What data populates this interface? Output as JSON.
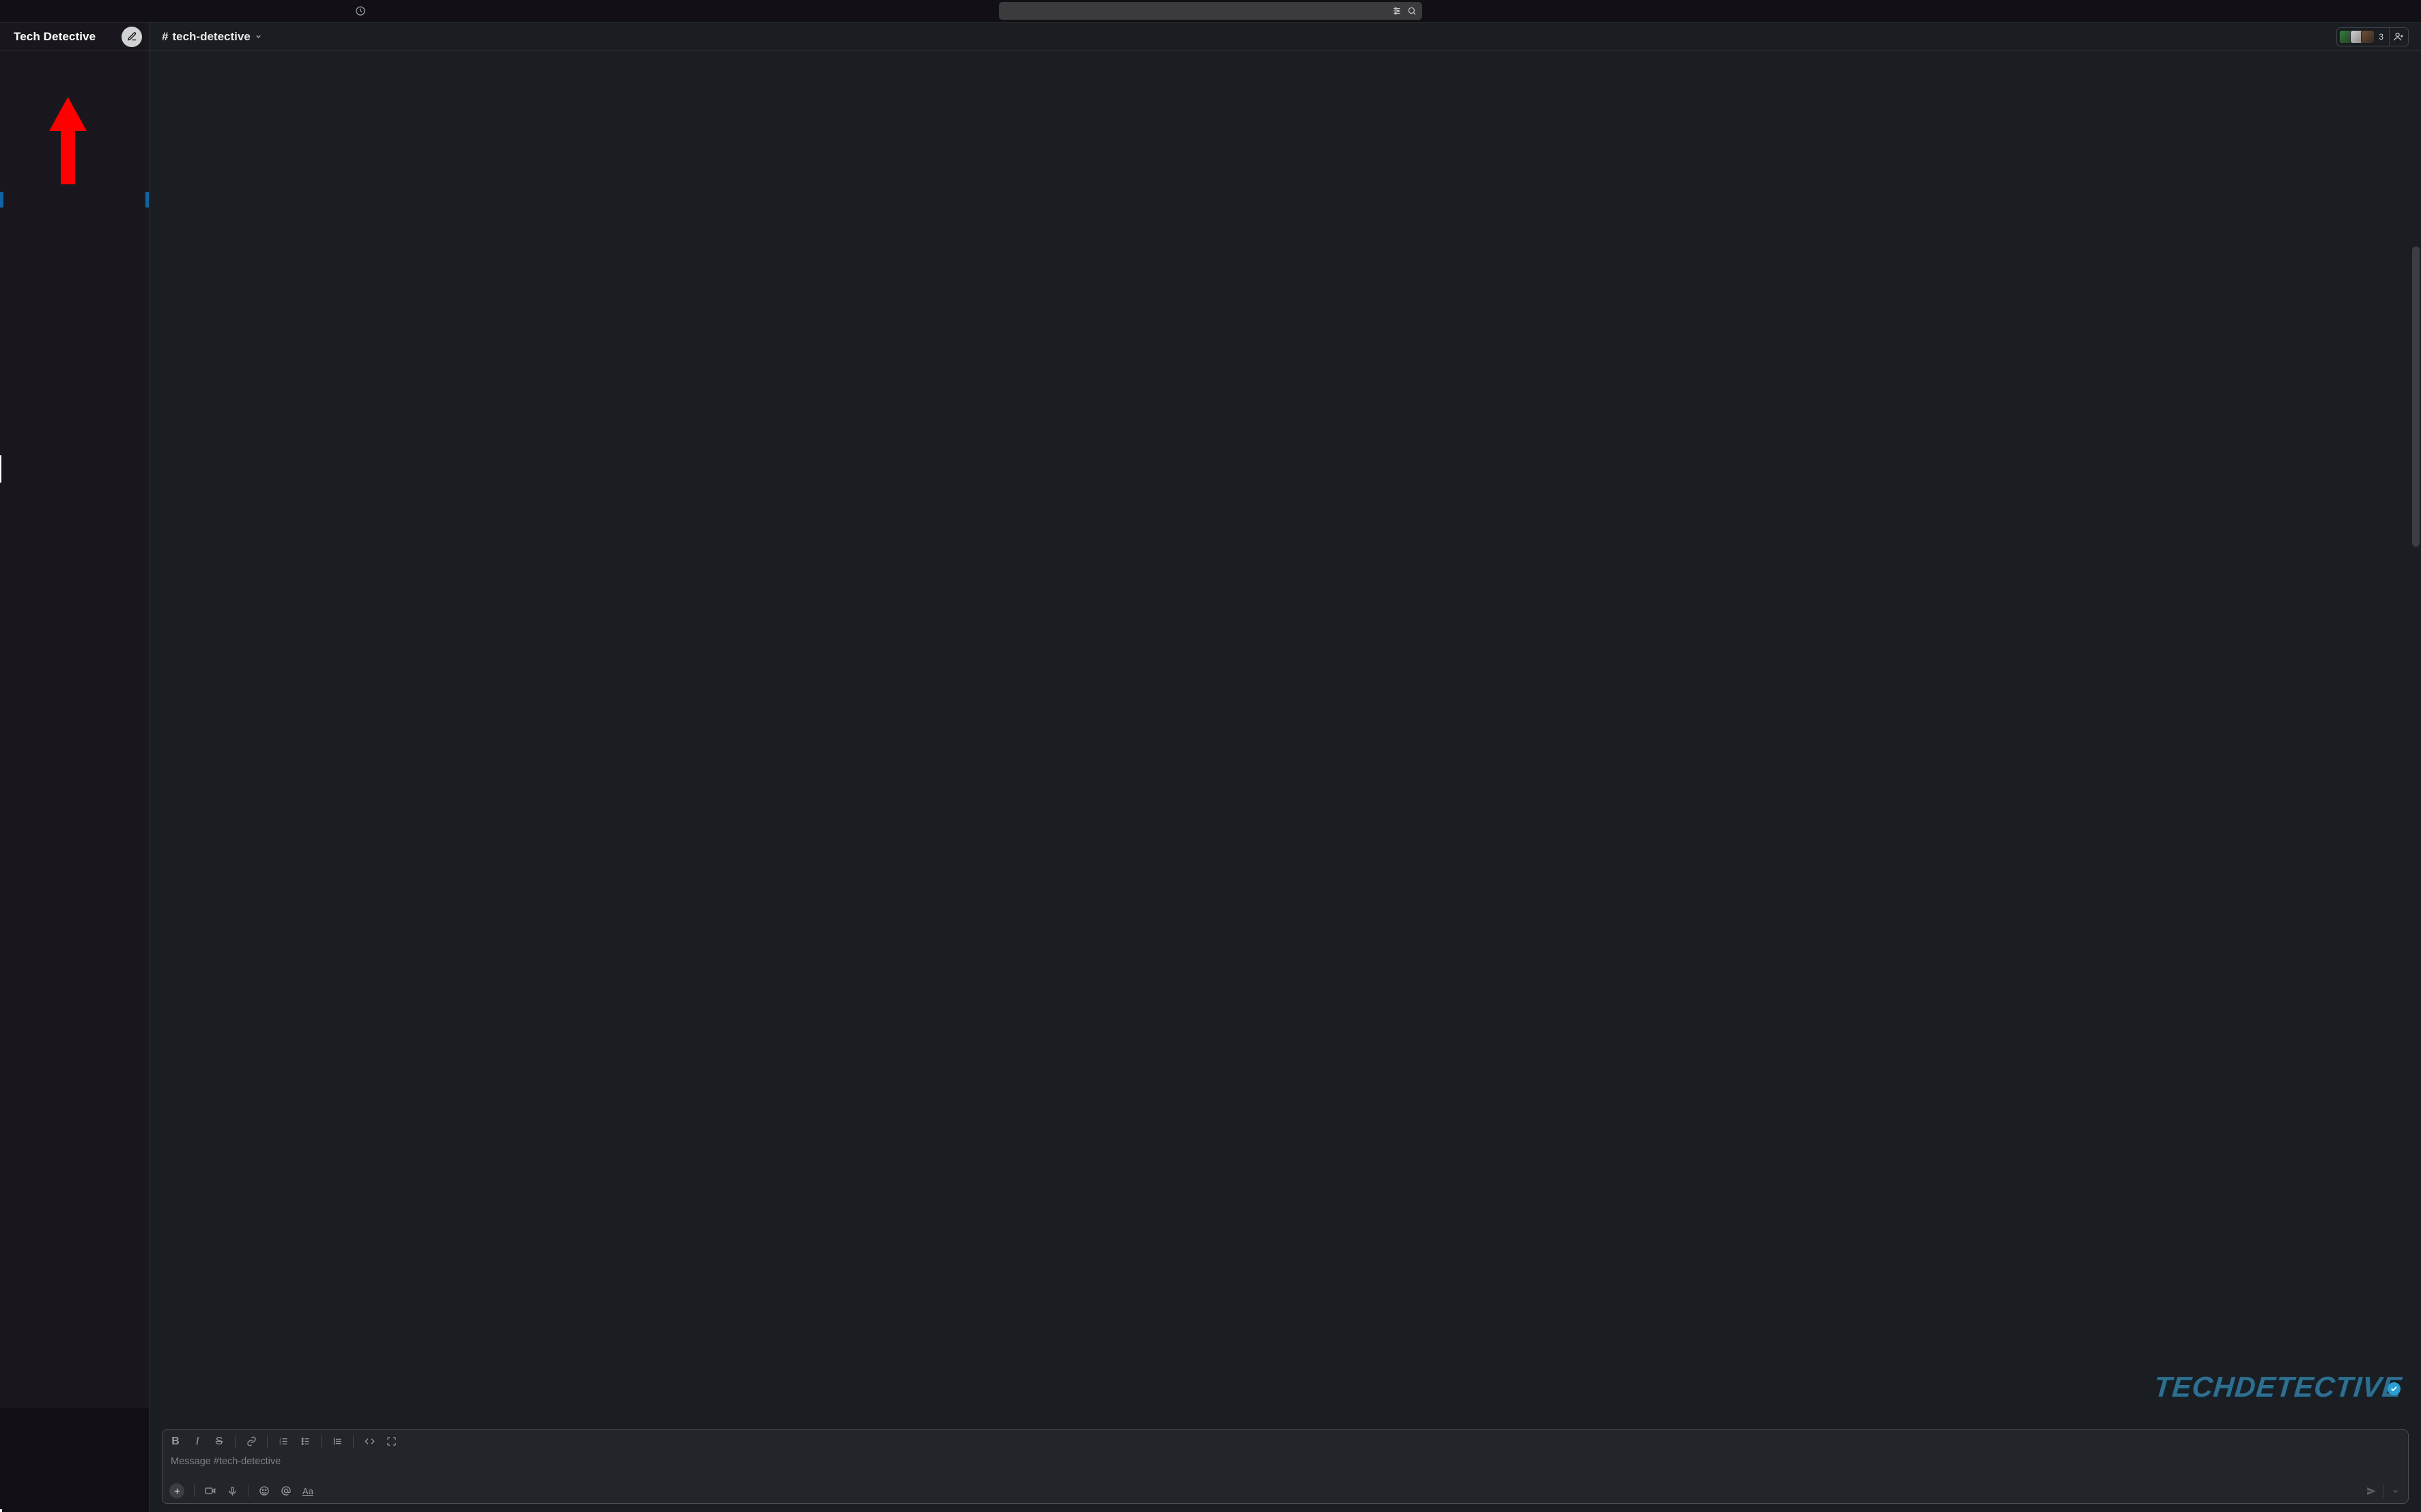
{
  "workspace": {
    "name": "Tech Detective"
  },
  "search": {
    "placeholder": ""
  },
  "channel": {
    "hash": "#",
    "name": "tech-detective",
    "member_count": "3"
  },
  "composer": {
    "placeholder": "Message #tech-detective",
    "formatting": {
      "bold": "B",
      "italic": "I",
      "strike": "S",
      "aa": "Aa"
    }
  },
  "icons": {
    "history": "history",
    "filter": "filter",
    "search": "search",
    "compose": "compose",
    "chevron_down": "chevron-down",
    "add_user": "add-user",
    "link": "link",
    "ordered_list": "ordered-list",
    "bullet_list": "bullet-list",
    "quote": "quote",
    "code": "code",
    "code_block": "code-block",
    "plus": "plus",
    "video": "video",
    "mic": "mic",
    "emoji": "emoji",
    "mention": "mention",
    "send": "send",
    "send_chevron": "chevron-down",
    "checkmark": "check"
  },
  "watermark": {
    "text": "TECHDETECTIVE"
  }
}
